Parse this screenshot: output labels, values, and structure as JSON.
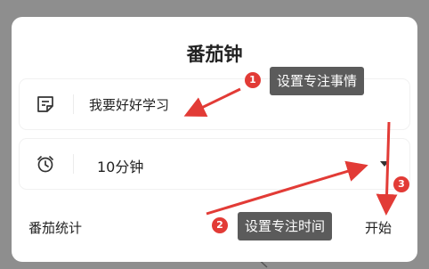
{
  "dialog": {
    "title": "番茄钟",
    "task_field": {
      "value": "我要好好学习"
    },
    "duration_select": {
      "selected": "10分钟"
    },
    "stats_label": "番茄统计",
    "start_label": "开始"
  },
  "annotations": [
    {
      "number": "1",
      "text": "设置专注事情"
    },
    {
      "number": "2",
      "text": "设置专注时间"
    },
    {
      "number": "3"
    }
  ],
  "colors": {
    "badge": "#e23b36",
    "arrow": "#e23b36",
    "tip_bg": "#5b5b5b"
  }
}
